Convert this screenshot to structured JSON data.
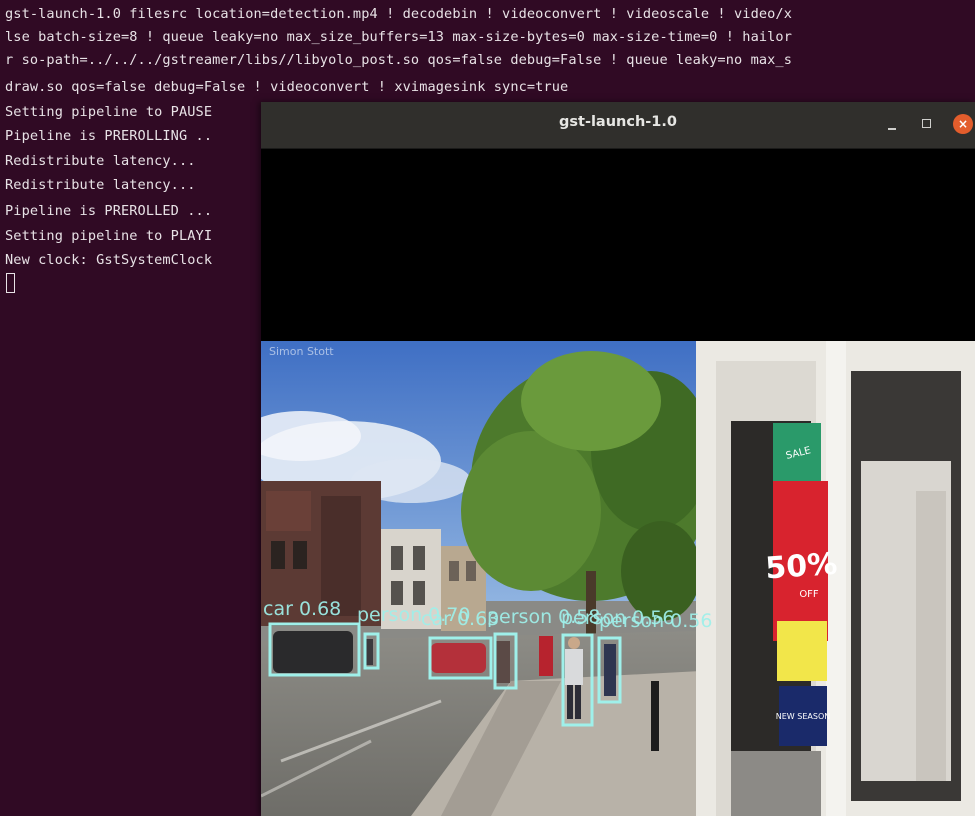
{
  "terminal": {
    "lines": [
      "gst-launch-1.0 filesrc location=detection.mp4 ! decodebin ! videoconvert ! videoscale ! video/x",
      "lse batch-size=8 ! queue leaky=no max_size_buffers=13 max-size-bytes=0 max-size-time=0 ! hailor",
      "r so-path=../../../gstreamer/libs//libyolo_post.so qos=false debug=False ! queue leaky=no max_s",
      "draw.so qos=false debug=False ! videoconvert ! xvimagesink sync=true",
      "Setting pipeline to PAUSE",
      "Pipeline is PREROLLING ..",
      "Redistribute latency...",
      "Redistribute latency...",
      "Pipeline is PREROLLED ...",
      "Setting pipeline to PLAYI",
      "New clock: GstSystemClock"
    ],
    "colors": {
      "background": "#300a24",
      "text": "#e8e2e6"
    }
  },
  "window": {
    "title": "gst-launch-1.0",
    "minimize_icon": "minimize-icon",
    "maximize_icon": "maximize-icon",
    "close_label": "×",
    "close_color": "#e35d2c"
  },
  "video": {
    "watermark": "Simon Stott",
    "detections": [
      {
        "label": "car 0.68",
        "class": "car",
        "confidence": 0.68
      },
      {
        "label": "person 0.70",
        "class": "person",
        "confidence": 0.7
      },
      {
        "label": "car 0.63",
        "class": "car",
        "confidence": 0.63
      },
      {
        "label": "person 0.58",
        "class": "person",
        "confidence": 0.58
      },
      {
        "label": "person 0.56",
        "class": "person",
        "confidence": 0.56
      },
      {
        "label": "person 0.56",
        "class": "person",
        "confidence": 0.56
      }
    ],
    "box_color": "#9ff0ea",
    "shop_sign": {
      "sale_text": "SALE",
      "percent": "50%",
      "percent_sub": "OFF",
      "poster_text": "NEW SEASON"
    }
  }
}
